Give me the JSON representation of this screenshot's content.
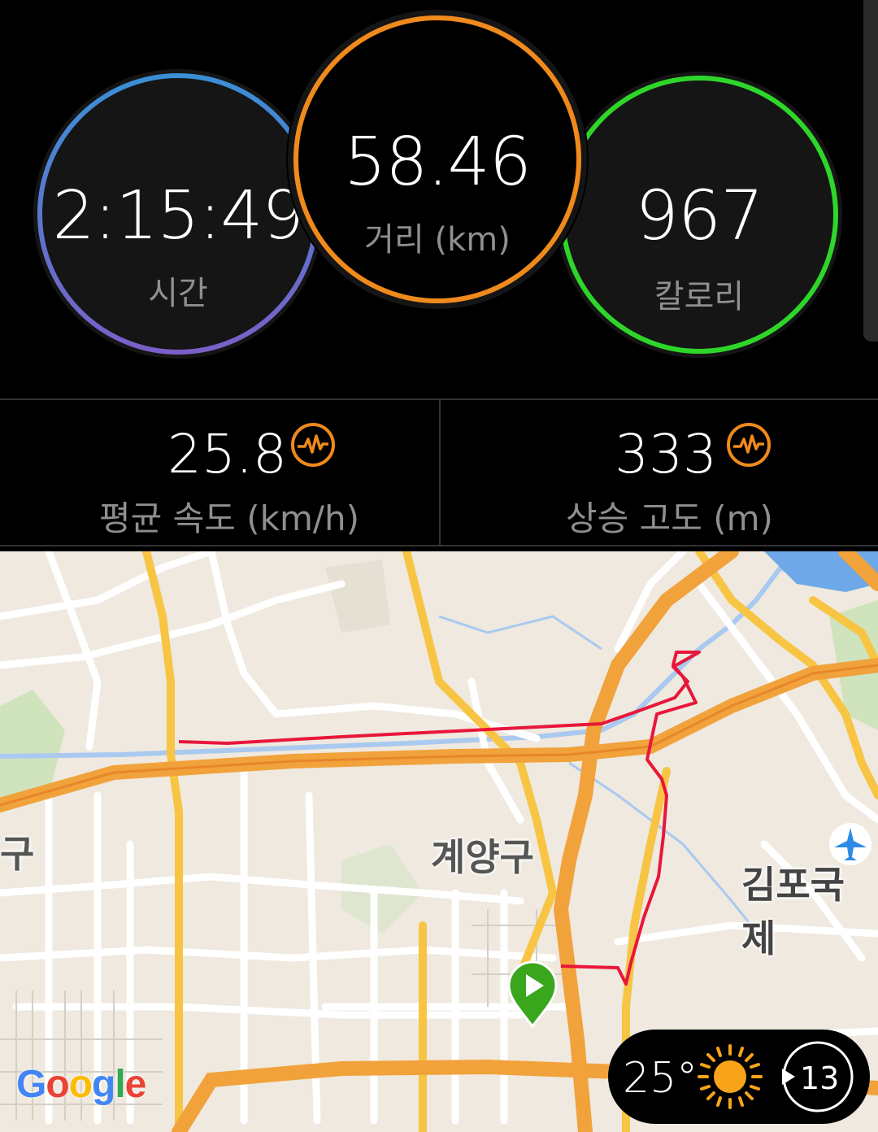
{
  "metrics": {
    "time": {
      "value": "2:15:49",
      "label": "시간"
    },
    "distance": {
      "value": "58.46",
      "label": "거리 (km)"
    },
    "calories": {
      "value": "967",
      "label": "칼로리"
    }
  },
  "stats": {
    "avg_speed": {
      "value": "25.8",
      "label": "평균 속도 (km/h)"
    },
    "elevation_gain": {
      "value": "333",
      "label": "상승 고도 (m)"
    }
  },
  "map": {
    "district_label": "계양구",
    "airport_label": "김포국제",
    "edge_label": "구",
    "google_logo": "Google"
  },
  "weather": {
    "temperature": "25°",
    "wind_speed": "13"
  },
  "colors": {
    "time_ring": [
      "#3a8fd6",
      "#7a5fc8"
    ],
    "distance_ring": "#f08a1c",
    "calories_ring": "#2ed62a",
    "route": "#e8173a",
    "start_pin": "#3aa61c"
  }
}
